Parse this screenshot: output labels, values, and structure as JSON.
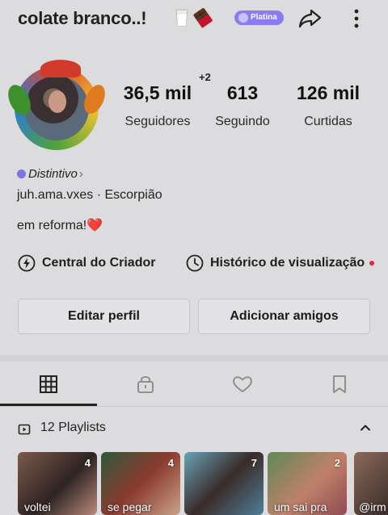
{
  "header": {
    "title": "colate branco..!",
    "badge_label": "Platina",
    "share_icon": "share-icon",
    "more_icon": "more-icon"
  },
  "profile": {
    "extra_count": "+2",
    "stats": [
      {
        "value": "36,5 mil",
        "label": "Seguidores"
      },
      {
        "value": "613",
        "label": "Seguindo"
      },
      {
        "value": "126 mil",
        "label": "Curtidas"
      }
    ],
    "distintivo_label": "Distintivo",
    "bio_line1": "juh.ama.vxes · Escorpião",
    "bio_line2": "em reforma!",
    "bio_emoji": "❤️"
  },
  "links": {
    "creator_center": "Central do Criador",
    "view_history": "Histórico de visualização"
  },
  "buttons": {
    "edit_profile": "Editar perfil",
    "add_friends": "Adicionar amigos"
  },
  "tabs": [
    "videos-grid-icon",
    "locked-icon",
    "liked-icon",
    "bookmark-icon"
  ],
  "playlists": {
    "label": "12 Playlists",
    "items": [
      {
        "count": "4",
        "caption": "voltei"
      },
      {
        "count": "4",
        "caption": "se pegar"
      },
      {
        "count": "7",
        "caption": ""
      },
      {
        "count": "2",
        "caption": "um sai pra"
      },
      {
        "count": "",
        "caption": "@irm"
      }
    ]
  },
  "colors": {
    "accent_purple": "#8a7cf0",
    "heart_red": "#d81f2e",
    "notification_red": "#e22b3b"
  }
}
